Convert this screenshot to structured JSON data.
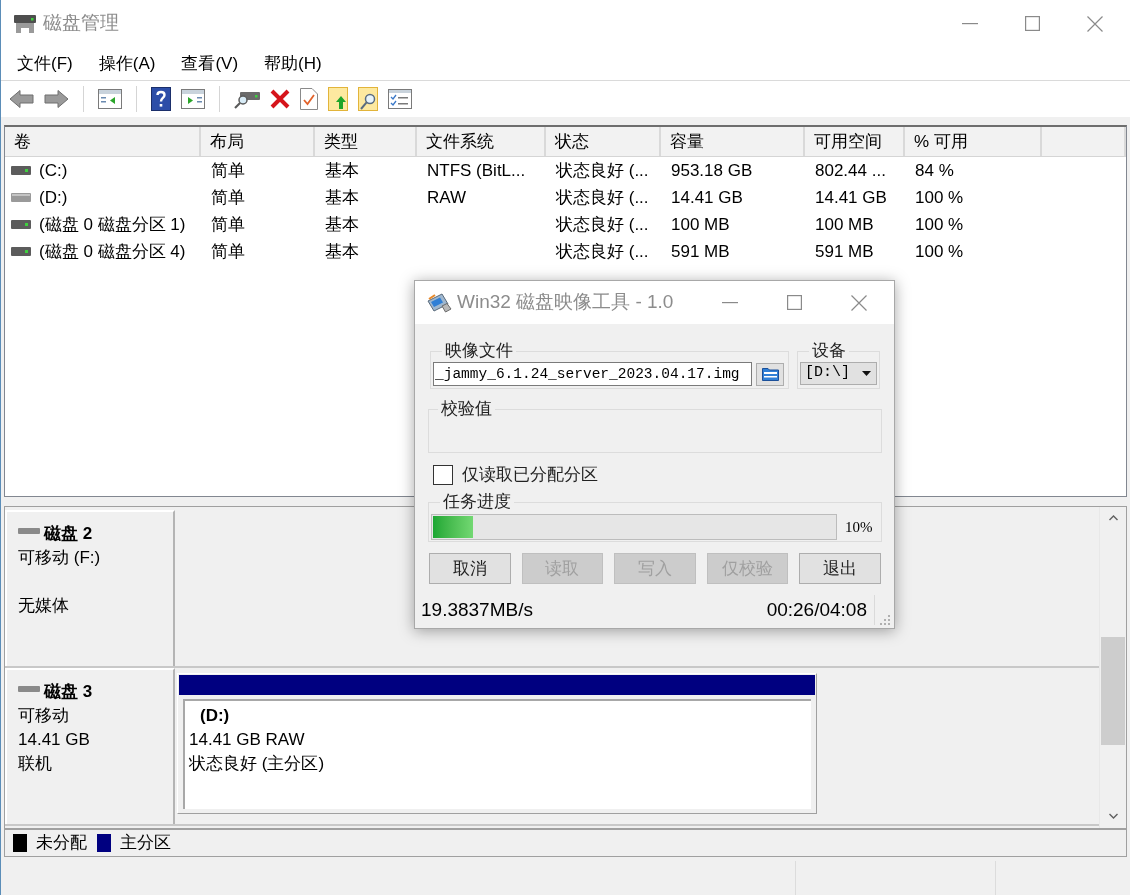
{
  "window": {
    "title": "磁盘管理"
  },
  "menu": [
    "文件(F)",
    "操作(A)",
    "查看(V)",
    "帮助(H)"
  ],
  "volumes": {
    "columns": [
      "卷",
      "布局",
      "类型",
      "文件系统",
      "状态",
      "容量",
      "可用空间",
      "% 可用"
    ],
    "rows": [
      {
        "kind": "fixed",
        "volume": "(C:)",
        "layout": "简单",
        "type": "基本",
        "file_system": "NTFS (BitL...",
        "status": "状态良好 (...",
        "capacity": "953.18 GB",
        "free_space": "802.44 ...",
        "percent_free": "84 %"
      },
      {
        "kind": "removable",
        "volume": "(D:)",
        "layout": "简单",
        "type": "基本",
        "file_system": "RAW",
        "status": "状态良好 (...",
        "capacity": "14.41 GB",
        "free_space": "14.41 GB",
        "percent_free": "100 %"
      },
      {
        "kind": "fixed",
        "volume": "(磁盘 0 磁盘分区 1)",
        "layout": "简单",
        "type": "基本",
        "status": "状态良好 (...",
        "capacity": "100 MB",
        "free_space": "100 MB",
        "percent_free": "100 %"
      },
      {
        "kind": "fixed",
        "volume": "(磁盘 0 磁盘分区 4)",
        "layout": "简单",
        "type": "基本",
        "status": "状态良好 (...",
        "capacity": "591 MB",
        "free_space": "591 MB",
        "percent_free": "100 %"
      }
    ]
  },
  "disks": [
    {
      "name": "磁盘 2",
      "type": "可移动 (F:)",
      "status": "无媒体"
    },
    {
      "name": "磁盘 3",
      "type": "可移动",
      "size": "14.41 GB",
      "status": "联机",
      "partitions": [
        {
          "label": "(D:)",
          "details": "14.41 GB RAW",
          "status": "状态良好 (主分区)",
          "color": "#000080"
        }
      ]
    }
  ],
  "legend": [
    {
      "label": "未分配",
      "color": "#000000"
    },
    {
      "label": "主分区",
      "color": "#000080"
    }
  ],
  "dialog": {
    "title": "Win32 磁盘映像工具 - 1.0",
    "image_file": {
      "label": "映像文件",
      "value": "_jammy_6.1.24_server_2023.04.17.img"
    },
    "device": {
      "label": "设备",
      "value": "[D:\\]"
    },
    "checksum": {
      "label": "校验值"
    },
    "allocated_only": {
      "label": "仅读取已分配分区",
      "checked": false
    },
    "progress": {
      "label": "任务进度",
      "level": 0.1,
      "reading": "10%"
    },
    "buttons": [
      {
        "label": "取消",
        "disabled": false
      },
      {
        "label": "读取",
        "disabled": true
      },
      {
        "label": "写入",
        "disabled": true
      },
      {
        "label": "仅校验",
        "disabled": true
      },
      {
        "label": "退出",
        "disabled": false
      }
    ],
    "speed": "19.3837MB/s",
    "time": "00:26/04:08"
  }
}
